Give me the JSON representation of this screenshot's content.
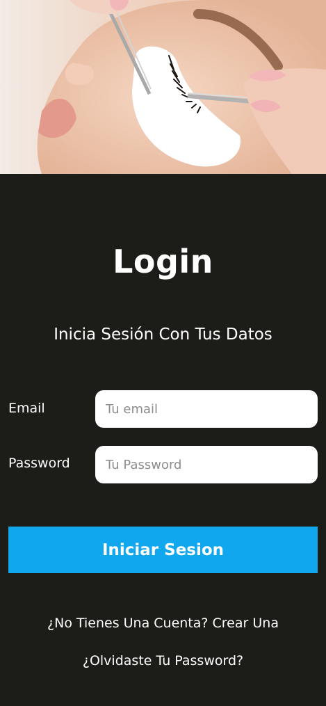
{
  "login": {
    "title": "Login",
    "subtitle": "Inicia Sesión Con Tus Datos",
    "email_label": "Email",
    "email_placeholder": "Tu email",
    "password_label": "Password",
    "password_placeholder": "Tu Password",
    "submit_label": "Iniciar Sesion",
    "signup_link": "¿No Tienes Una Cuenta? Crear Una",
    "forgot_link": "¿Olvidaste Tu Password?"
  },
  "colors": {
    "background": "#1c1c18",
    "accent": "#10a7ee",
    "input_background": "#ffffff"
  },
  "icons": []
}
